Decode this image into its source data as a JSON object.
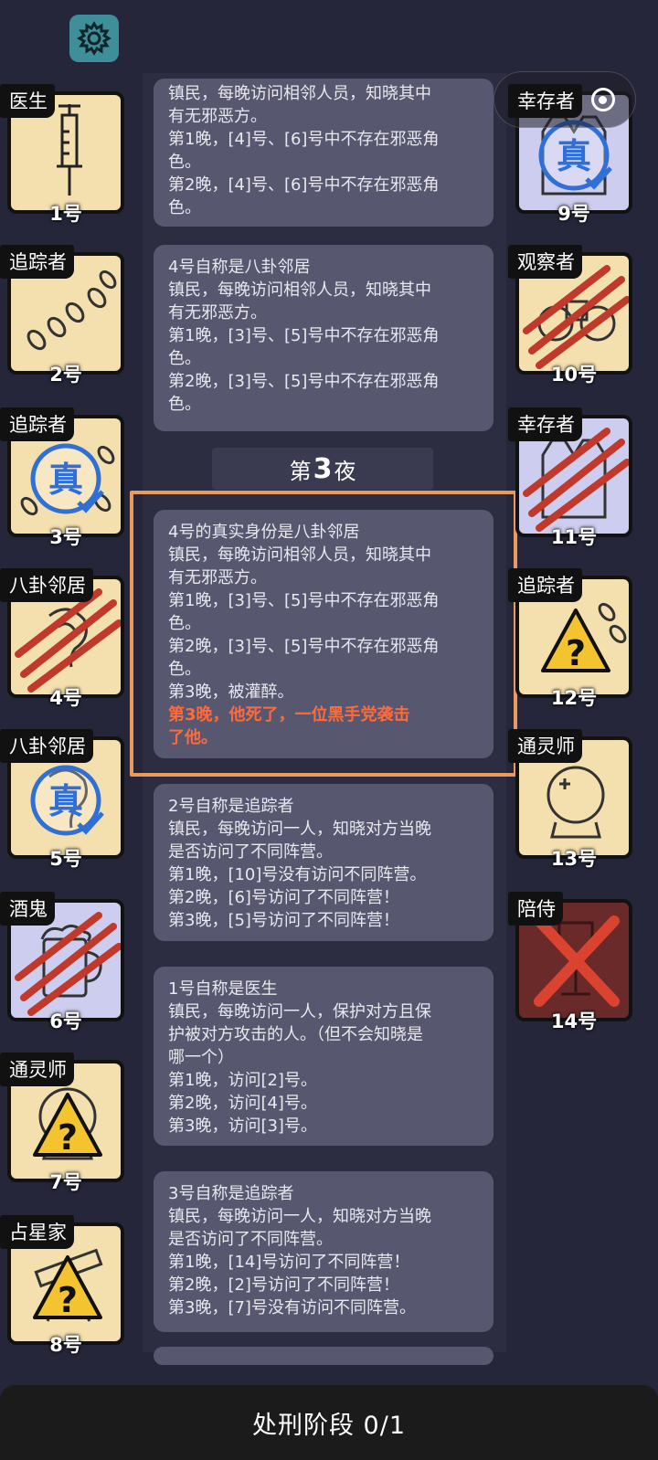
{
  "header": {
    "settings_icon": "gear-icon",
    "capsule": {
      "more_label": "•••",
      "close_icon": "record-icon"
    }
  },
  "players": [
    {
      "id": "p1",
      "role": "医生",
      "number": "1号",
      "icon": "syringe"
    },
    {
      "id": "p2",
      "role": "追踪者",
      "number": "2号",
      "icon": "footprints"
    },
    {
      "id": "p3",
      "role": "追踪者",
      "number": "3号",
      "icon": "footprints",
      "stamp": "真"
    },
    {
      "id": "p4",
      "role": "八卦邻居",
      "number": "4号",
      "icon": "ear",
      "status": "dead"
    },
    {
      "id": "p5",
      "role": "八卦邻居",
      "number": "5号",
      "icon": "ear",
      "stamp": "真"
    },
    {
      "id": "p6",
      "role": "酒鬼",
      "number": "6号",
      "icon": "beer-mug",
      "status": "dead"
    },
    {
      "id": "p7",
      "role": "通灵师",
      "number": "7号",
      "icon": "crystal-ball",
      "mark": "?"
    },
    {
      "id": "p8",
      "role": "占星家",
      "number": "8号",
      "icon": "telescope",
      "mark": "?"
    },
    {
      "id": "p9",
      "role": "幸存者",
      "number": "9号",
      "icon": "vest",
      "stamp": "真"
    },
    {
      "id": "p10",
      "role": "观察者",
      "number": "10号",
      "icon": "binoculars",
      "status": "dead"
    },
    {
      "id": "p11",
      "role": "幸存者",
      "number": "11号",
      "icon": "vest",
      "status": "dead"
    },
    {
      "id": "p12",
      "role": "追踪者",
      "number": "12号",
      "icon": "footprints",
      "mark": "?"
    },
    {
      "id": "p13",
      "role": "通灵师",
      "number": "13号",
      "icon": "crystal-ball"
    },
    {
      "id": "p14",
      "role": "陪侍",
      "number": "14号",
      "icon": "wine-glass",
      "status": "executed"
    }
  ],
  "log": {
    "entry0": [
      "镇民，每晚访问相邻人员，知晓其中",
      "有无邪恶方。",
      "第1晚，[4]号、[6]号中不存在邪恶角",
      "色。",
      "第2晚，[4]号、[6]号中不存在邪恶角",
      "色。"
    ],
    "entry1": [
      "4号自称是八卦邻居",
      "镇民，每晚访问相邻人员，知晓其中",
      "有无邪恶方。",
      "第1晚，[3]号、[5]号中不存在邪恶角",
      "色。",
      "第2晚，[3]号、[5]号中不存在邪恶角",
      "色。"
    ],
    "night_prefix": "第",
    "night_number": "3",
    "night_suffix": "夜",
    "entry2": [
      "4号的真实身份是八卦邻居",
      "镇民，每晚访问相邻人员，知晓其中",
      "有无邪恶方。",
      "第1晚，[3]号、[5]号中不存在邪恶角",
      "色。",
      "第2晚，[3]号、[5]号中不存在邪恶角",
      "色。",
      "第3晚，被灌醉。"
    ],
    "entry2_red": [
      "第3晚，他死了，一位黑手党袭击",
      "了他。"
    ],
    "entry3": [
      "2号自称是追踪者",
      "镇民，每晚访问一人，知晓对方当晚",
      "是否访问了不同阵营。",
      "第1晚，[10]号没有访问不同阵营。",
      "第2晚，[6]号访问了不同阵营！",
      "第3晚，[5]号访问了不同阵营！"
    ],
    "entry4": [
      "1号自称是医生",
      "镇民，每晚访问一人，保护对方且保",
      "护被对方攻击的人。（但不会知晓是",
      "哪一个）",
      "第1晚，访问[2]号。",
      "第2晚，访问[4]号。",
      "第3晚，访问[3]号。"
    ],
    "entry5": [
      "3号自称是追踪者",
      "镇民，每晚访问一人，知晓对方当晚",
      "是否访问了不同阵营。",
      "第1晚，[14]号访问了不同阵营！",
      "第2晚，[2]号访问了不同阵营！",
      "第3晚，[7]号没有访问不同阵营。"
    ]
  },
  "bottom_bar": {
    "label": "处刑阶段 0/1"
  },
  "colors": {
    "background": "#26263a",
    "card_cream": "#f4dfae",
    "card_lavender": "#cdcdf0",
    "log_card": "#575870",
    "highlight": "#e99a5c",
    "alert_text": "#ff6a3c",
    "slash": "#c0392b",
    "true_stamp": "#2f6fd6",
    "warning": "#f4c430"
  }
}
